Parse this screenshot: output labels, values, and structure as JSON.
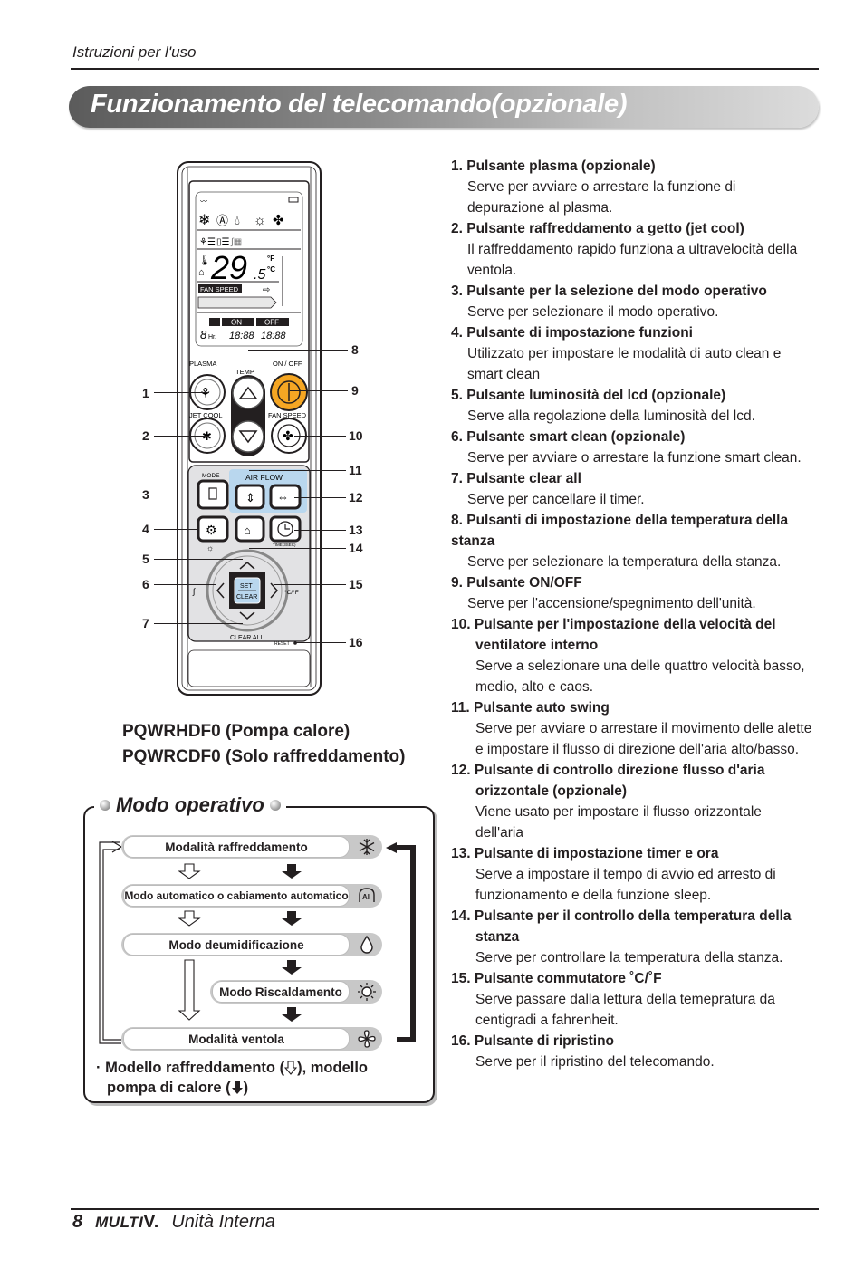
{
  "header": {
    "running_head": "Istruzioni per l'uso",
    "title": "Funzionamento del telecomando(opzionale)"
  },
  "remote": {
    "lcd": {
      "temperature": "29",
      "temperature_decimal": ".5",
      "unit_f": "°F",
      "unit_c": "°C",
      "fan_speed_label": "FAN SPEED",
      "timer_on": "ON",
      "timer_off": "OFF",
      "hours": "8",
      "hours_unit": "Hr.",
      "time_on": "18:88",
      "time_off": "18:88"
    },
    "labels": {
      "plasma": "PLASMA",
      "temp": "TEMP",
      "on_off": "ON / OFF",
      "jet_cool": "JET COOL",
      "fan_speed": "FAN SPEED",
      "mode": "MODE",
      "air_flow": "AIR FLOW",
      "time_sec": "TIME(3SEC)",
      "set": "SET",
      "clear": "CLEAR",
      "clear_all": "CLEAR ALL",
      "reset": "RESET",
      "cf": "°C/°F"
    },
    "callouts": [
      "1",
      "2",
      "3",
      "4",
      "5",
      "6",
      "7",
      "8",
      "9",
      "10",
      "11",
      "12",
      "13",
      "14",
      "15",
      "16"
    ],
    "colors": {
      "power_button": "#f5a623",
      "air_flow_panel": "#b9d7ee",
      "lower_panel": "#e2e2e4"
    }
  },
  "models": {
    "line1": "PQWRHDF0 (Pompa calore)",
    "line2": "PQWRCDF0 (Solo raffreddamento)"
  },
  "mode_box": {
    "title": "Modo operativo",
    "modes": [
      {
        "label": "Modalità raffreddamento",
        "icon": "snowflake-icon"
      },
      {
        "label": "Modo automatico o cabiamento automatico",
        "icon": "auto-ai-icon"
      },
      {
        "label": "Modo deumidificazione",
        "icon": "droplet-icon"
      },
      {
        "label": "Modo Riscaldamento",
        "icon": "sun-icon"
      },
      {
        "label": "Modalità ventola",
        "icon": "fan-icon"
      }
    ],
    "note_line1": "· Modello raffreddamento (",
    "note_mid": "), modello",
    "note_line2": "pompa di calore (",
    "note_end": ")"
  },
  "descriptions": [
    {
      "title": "1. Pulsante plasma (opzionale)",
      "body": "Serve per avviare o arrestare la funzione di depurazione al plasma."
    },
    {
      "title": "2. Pulsante raffreddamento a getto (jet cool)",
      "body": "Il raffreddamento rapido funziona a ultravelocità della ventola."
    },
    {
      "title": "3. Pulsante per la selezione del modo operativo",
      "body": "Serve per selezionare il modo operativo."
    },
    {
      "title": "4. Pulsante di impostazione funzioni",
      "body": "Utilizzato per impostare le modalità di auto clean e smart clean"
    },
    {
      "title": "5. Pulsante luminosità del lcd (opzionale)",
      "body": "Serve alla regolazione della luminosità del lcd."
    },
    {
      "title": "6. Pulsante smart clean (opzionale)",
      "body": "Serve per avviare o arrestare la funzione smart clean."
    },
    {
      "title": "7. Pulsante clear all",
      "body": "Serve per cancellare il timer."
    },
    {
      "title": "8. Pulsanti di impostazione della temperatura della stanza",
      "body": "Serve per selezionare la temperatura della stanza."
    },
    {
      "title": "9. Pulsante ON/OFF",
      "body": "Serve per l'accensione/spegnimento dell'unità."
    },
    {
      "title": "10. Pulsante per l'impostazione della velocità del ventilatore interno",
      "body": "Serve a selezionare una delle quattro velocità basso, medio, alto e caos."
    },
    {
      "title": "11. Pulsante auto swing",
      "body": "Serve per avviare o arrestare il movimento delle alette e impostare il flusso di direzione dell'aria alto/basso."
    },
    {
      "title": "12. Pulsante di controllo direzione flusso d'aria orizzontale (opzionale)",
      "body": "Viene usato per impostare il flusso orizzontale dell'aria"
    },
    {
      "title": "13. Pulsante di impostazione timer e ora",
      "body": "Serve a impostare il tempo di avvio ed arresto di funzionamento e della funzione sleep."
    },
    {
      "title": "14. Pulsante per il controllo della temperatura della stanza",
      "body": "Serve per controllare la temperatura della stanza."
    },
    {
      "title": "15. Pulsante commutatore ˚C/˚F",
      "body": "Serve passare dalla lettura della temepratura da centigradi a fahrenheit."
    },
    {
      "title": "16. Pulsante di ripristino",
      "body": "Serve per il ripristino del telecomando."
    }
  ],
  "footer": {
    "page_number": "8",
    "brand": "MULTI",
    "brand_v": "V.",
    "section": "Unità Interna"
  }
}
